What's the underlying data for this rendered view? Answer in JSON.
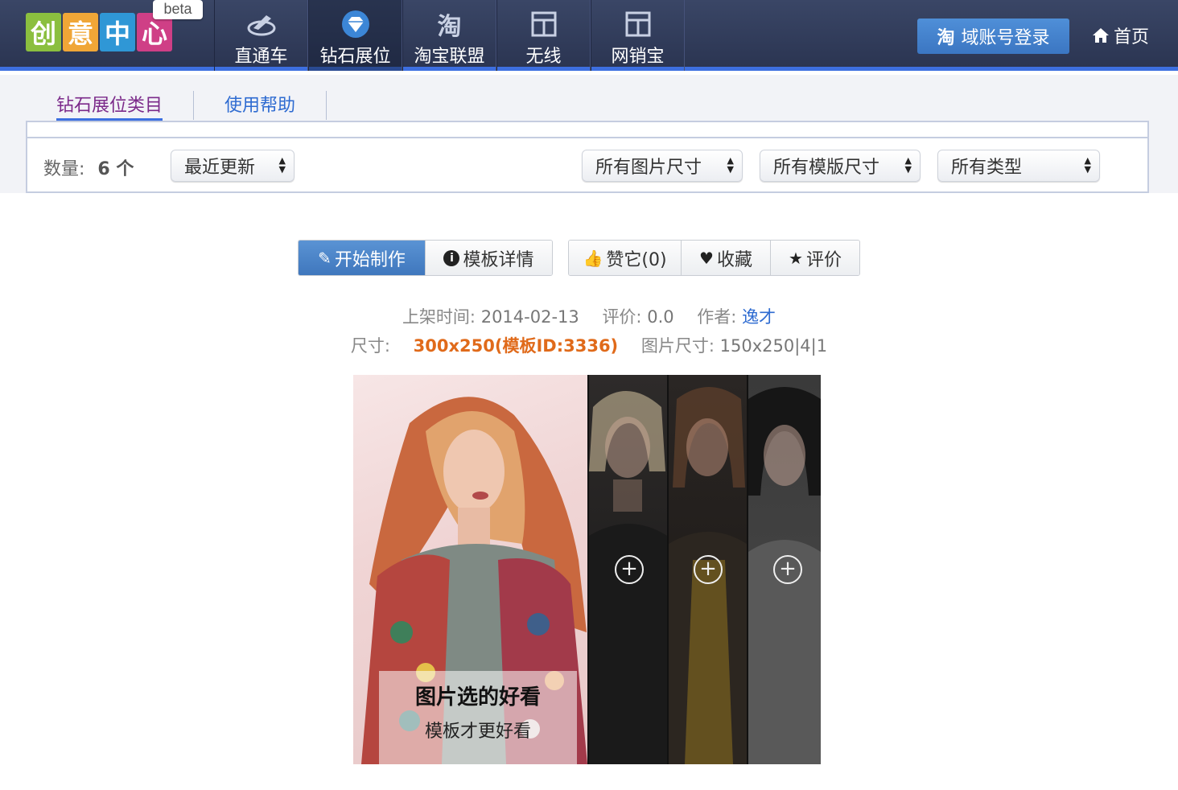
{
  "nav": {
    "logo_chars": [
      "创",
      "意",
      "中",
      "心"
    ],
    "logo_colors": [
      "#8bbf3f",
      "#f0a637",
      "#2f97d6",
      "#cf3f86"
    ],
    "logo_badge": "beta",
    "items": [
      {
        "label": "直通车",
        "icon": "car-steering-icon"
      },
      {
        "label": "钻石展位",
        "icon": "diamond-icon"
      },
      {
        "label": "淘宝联盟",
        "icon": "taobao-icon"
      },
      {
        "label": "无线",
        "icon": "layout-icon"
      },
      {
        "label": "网销宝",
        "icon": "layout-icon"
      }
    ],
    "active_index": 1,
    "login_label": "域账号登录",
    "home_label": "首页"
  },
  "tabs": [
    "钻石展位类目",
    "使用帮助"
  ],
  "filters": {
    "count_label": "数量:",
    "count_value": "6 个",
    "sort": "最近更新",
    "image_size": "所有图片尺寸",
    "template_size": "所有模版尺寸",
    "type": "所有类型"
  },
  "actions": {
    "start": "开始制作",
    "details": "模板详情",
    "like": "赞它(0)",
    "favorite": "收藏",
    "rate": "评价"
  },
  "meta": {
    "listed_label": "上架时间:",
    "listed_value": "2014-02-13",
    "rating_label": "评价:",
    "rating_value": "0.0",
    "author_label": "作者:",
    "author_value": "逸才",
    "size_label": "尺寸:",
    "size_value": "300x250(模板ID:3336)",
    "image_size_label": "图片尺寸:",
    "image_size_value": "150x250|4|1"
  },
  "preview": {
    "caption_line1": "图片选的好看",
    "caption_line2": "模板才更好看",
    "plus_symbol": "+"
  }
}
